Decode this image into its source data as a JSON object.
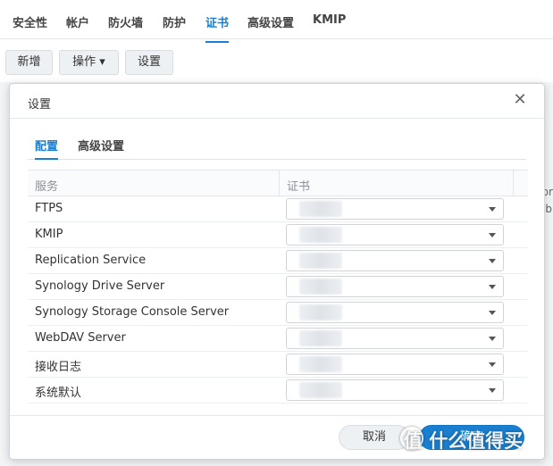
{
  "top_tabs": [
    {
      "label": "安全性"
    },
    {
      "label": "帐户"
    },
    {
      "label": "防火墙"
    },
    {
      "label": "防护"
    },
    {
      "label": "证书"
    },
    {
      "label": "高级设置"
    },
    {
      "label": "KMIP"
    }
  ],
  "active_top_tab": "证书",
  "toolbar": {
    "add_label": "新增",
    "action_label": "操作 ▾",
    "settings_label": "设置"
  },
  "background_fragments": [
    "lbr",
    "eb"
  ],
  "dialog": {
    "title": "设置",
    "tabs": [
      {
        "label": "配置"
      },
      {
        "label": "高级设置"
      }
    ],
    "active_tab": "配置",
    "table": {
      "headers": {
        "service": "服务",
        "certificate": "证书"
      },
      "rows": [
        {
          "service": "FTPS"
        },
        {
          "service": "KMIP"
        },
        {
          "service": "Replication Service"
        },
        {
          "service": "Synology Drive Server"
        },
        {
          "service": "Synology Storage Console Server"
        },
        {
          "service": "WebDAV Server"
        },
        {
          "service": "接收日志"
        },
        {
          "service": "系统默认"
        }
      ]
    },
    "cancel_label": "取消",
    "ok_label": "确定"
  },
  "watermark": "值 什么值得买",
  "colors": {
    "accent": "#1a7fd0"
  }
}
